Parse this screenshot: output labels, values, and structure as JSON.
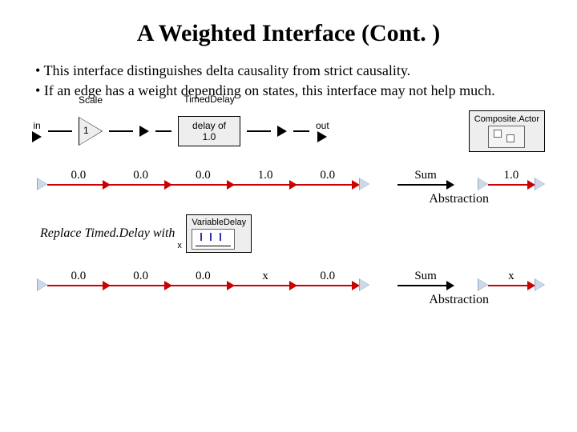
{
  "title": "A Weighted Interface (Cont. )",
  "bullets": [
    "This interface distinguishes delta causality from strict causality.",
    "If an edge has a weight depending on states, this interface may not help much."
  ],
  "diagram": {
    "in": "in",
    "scale_label": "Scale",
    "scale_value": "1",
    "delay_label": "TimedDelay",
    "delay_text_top": "delay of",
    "delay_text_bottom": "1.0",
    "out": "out",
    "composite_label": "Composite.Actor"
  },
  "row1": {
    "values": [
      "0.0",
      "0.0",
      "0.0",
      "1.0",
      "0.0"
    ],
    "sum": "Sum",
    "sum_val": "1.0",
    "abstraction": "Abstraction"
  },
  "replace": {
    "text": "Replace Timed.Delay with",
    "box_label": "VariableDelay",
    "x": "x"
  },
  "row2": {
    "values": [
      "0.0",
      "0.0",
      "0.0",
      "x",
      "0.0"
    ],
    "sum": "Sum",
    "sum_val": "x",
    "abstraction": "Abstraction"
  }
}
